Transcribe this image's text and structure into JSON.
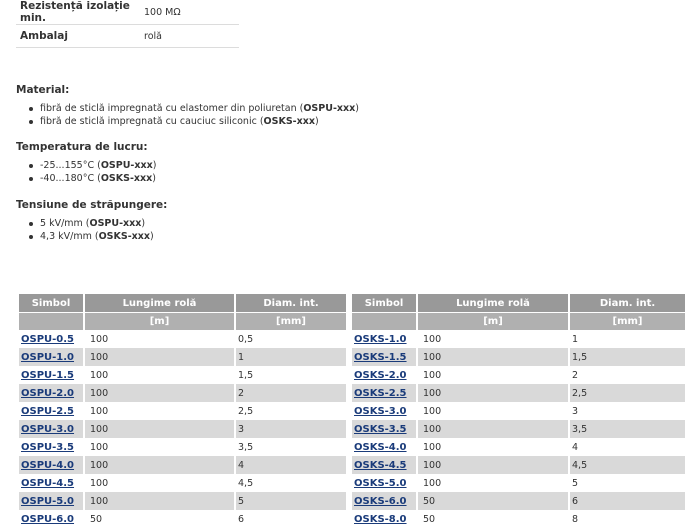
{
  "specs": [
    {
      "label": "Rezistență izolație min.",
      "value": "100 MΩ"
    },
    {
      "label": "Ambalaj",
      "value": "rolă"
    }
  ],
  "sections": {
    "material": {
      "title": "Material:",
      "items": [
        {
          "text": "fibră de sticlă impregnată cu elastomer din poliuretan (",
          "code": "OSPU-xxx",
          "suffix": ")"
        },
        {
          "text": "fibră de sticlă impregnată cu cauciuc siliconic (",
          "code": "OSKS-xxx",
          "suffix": ")"
        }
      ]
    },
    "temperature": {
      "title": "Temperatura de lucru:",
      "items": [
        {
          "text": "-25...155°C (",
          "code": "OSPU-xxx",
          "suffix": ")"
        },
        {
          "text": "-40...180°C (",
          "code": "OSKS-xxx",
          "suffix": ")"
        }
      ]
    },
    "voltage": {
      "title": "Tensiune de străpungere:",
      "items": [
        {
          "text": "5 kV/mm (",
          "code": "OSPU-xxx",
          "suffix": ")"
        },
        {
          "text": "4,3 kV/mm (",
          "code": "OSKS-xxx",
          "suffix": ")"
        }
      ]
    }
  },
  "table_headers": {
    "symbol": "Simbol",
    "length": "Lungime rolă",
    "diameter": "Diam. int.",
    "length_unit": "[m]",
    "diameter_unit": "[mm]"
  },
  "tables": [
    {
      "rows": [
        {
          "symbol": "OSPU-0.5",
          "length": "100",
          "diameter": "0,5"
        },
        {
          "symbol": "OSPU-1.0",
          "length": "100",
          "diameter": "1"
        },
        {
          "symbol": "OSPU-1.5",
          "length": "100",
          "diameter": "1,5"
        },
        {
          "symbol": "OSPU-2.0",
          "length": "100",
          "diameter": "2"
        },
        {
          "symbol": "OSPU-2.5",
          "length": "100",
          "diameter": "2,5"
        },
        {
          "symbol": "OSPU-3.0",
          "length": "100",
          "diameter": "3"
        },
        {
          "symbol": "OSPU-3.5",
          "length": "100",
          "diameter": "3,5"
        },
        {
          "symbol": "OSPU-4.0",
          "length": "100",
          "diameter": "4"
        },
        {
          "symbol": "OSPU-4.5",
          "length": "100",
          "diameter": "4,5"
        },
        {
          "symbol": "OSPU-5.0",
          "length": "100",
          "diameter": "5"
        },
        {
          "symbol": "OSPU-6.0",
          "length": "50",
          "diameter": "6"
        }
      ]
    },
    {
      "rows": [
        {
          "symbol": "OSKS-1.0",
          "length": "100",
          "diameter": "1"
        },
        {
          "symbol": "OSKS-1.5",
          "length": "100",
          "diameter": "1,5"
        },
        {
          "symbol": "OSKS-2.0",
          "length": "100",
          "diameter": "2"
        },
        {
          "symbol": "OSKS-2.5",
          "length": "100",
          "diameter": "2,5"
        },
        {
          "symbol": "OSKS-3.0",
          "length": "100",
          "diameter": "3"
        },
        {
          "symbol": "OSKS-3.5",
          "length": "100",
          "diameter": "3,5"
        },
        {
          "symbol": "OSKS-4.0",
          "length": "100",
          "diameter": "4"
        },
        {
          "symbol": "OSKS-4.5",
          "length": "100",
          "diameter": "4,5"
        },
        {
          "symbol": "OSKS-5.0",
          "length": "100",
          "diameter": "5"
        },
        {
          "symbol": "OSKS-6.0",
          "length": "50",
          "diameter": "6"
        },
        {
          "symbol": "OSKS-8.0",
          "length": "50",
          "diameter": "8"
        }
      ]
    }
  ]
}
